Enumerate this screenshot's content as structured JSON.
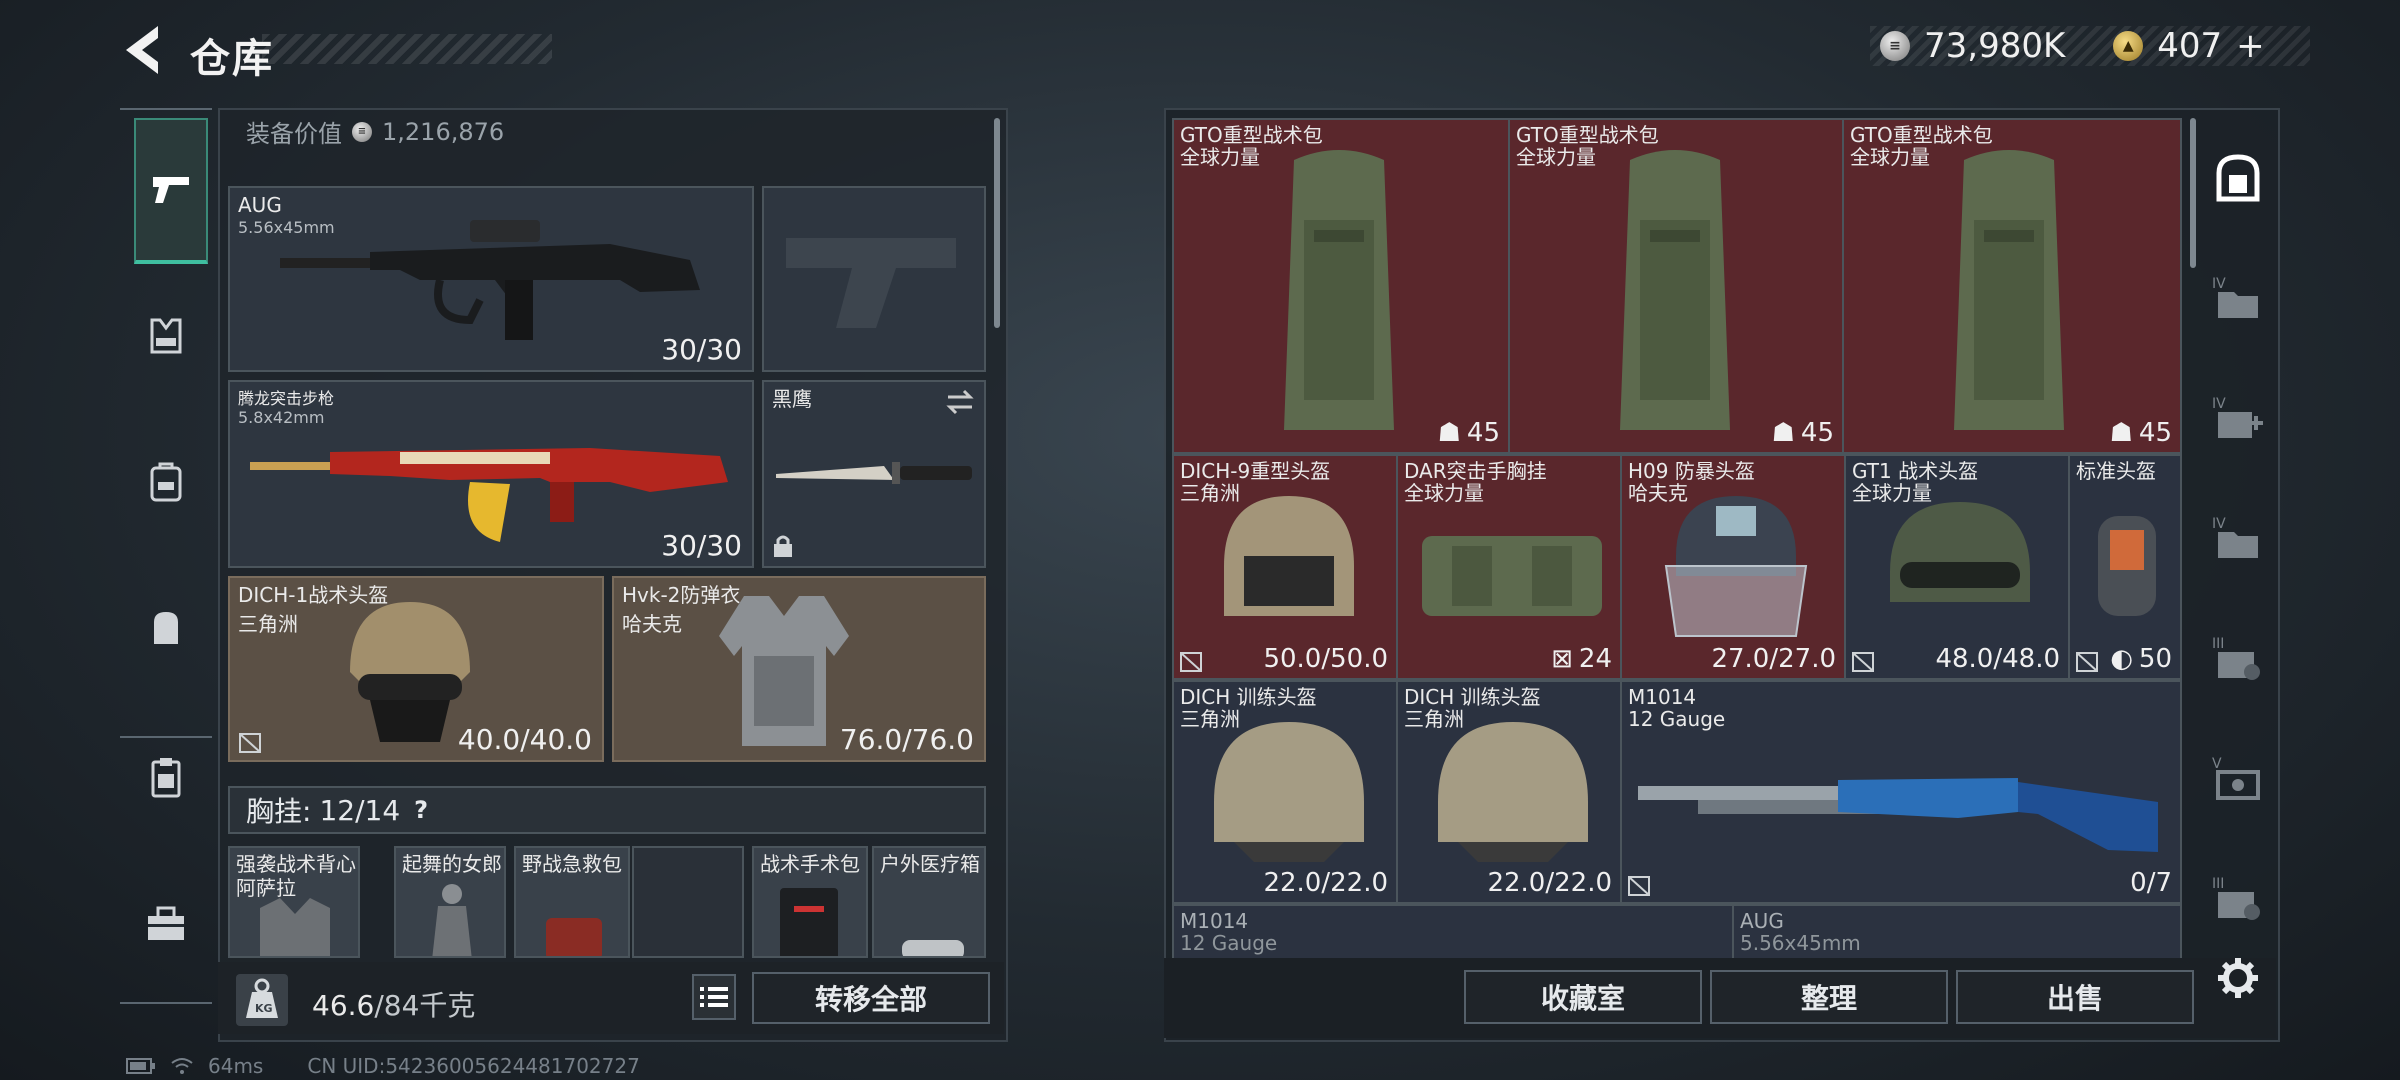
{
  "header": {
    "title": "仓库",
    "currency": [
      {
        "icon": "silver-coin-icon",
        "value": "73,980K"
      },
      {
        "icon": "gold-coin-icon",
        "value": "407",
        "plus": "+"
      }
    ]
  },
  "left_nav": {
    "items": [
      "weapon-icon",
      "vest-icon",
      "backpack-icon",
      "bag-icon",
      "clipboard-icon",
      "toolbox-icon"
    ]
  },
  "equipment": {
    "value_label": "装备价值",
    "value": "1,216,876",
    "slots": [
      {
        "name": "AUG",
        "caliber": "5.56x45mm",
        "value": "30/30"
      },
      {
        "name": "",
        "caliber": "",
        "value": ""
      },
      {
        "name": "腾龙突击步枪",
        "caliber": "5.8x42mm",
        "value": "30/30"
      },
      {
        "name": "黑鹰",
        "caliber": "",
        "value": ""
      },
      {
        "name": "DICH-1战术头盔",
        "sub": "三角洲",
        "value": "40.0/40.0"
      },
      {
        "name": "Hvk-2防弹衣",
        "sub": "哈夫克",
        "value": "76.0/76.0"
      }
    ],
    "chest": {
      "label": "胸挂:",
      "value": "12/14",
      "help": "?"
    },
    "chest_items": [
      {
        "name": "强袭战术背心",
        "sub": "阿萨拉"
      },
      {
        "name": "起舞的女郎",
        "sub": ""
      },
      {
        "name": "野战急救包",
        "sub": ""
      },
      {
        "name": "",
        "sub": ""
      },
      {
        "name": "战术手术包",
        "sub": ""
      },
      {
        "name": "户外医疗箱",
        "sub": ""
      }
    ]
  },
  "bottom_left": {
    "weight_current": "46.6",
    "weight_max": "/84千克",
    "transfer_all": "转移全部"
  },
  "status": {
    "ping": "64ms",
    "uid": "CN UID:54236005624481702727"
  },
  "storage": {
    "row1": [
      {
        "name": "GTO重型战术包",
        "sub": "全球力量",
        "count": "45"
      },
      {
        "name": "GTO重型战术包",
        "sub": "全球力量",
        "count": "45"
      },
      {
        "name": "GTO重型战术包",
        "sub": "全球力量",
        "count": "45"
      }
    ],
    "row2": [
      {
        "name": "DICH-9重型头盔",
        "sub": "三角洲",
        "value": "50.0/50.0"
      },
      {
        "name": "DAR突击手胸挂",
        "sub": "全球力量",
        "value": "24"
      },
      {
        "name": "H09 防暴头盔",
        "sub": "哈夫克",
        "value": "27.0/27.0"
      },
      {
        "name": "GT1 战术头盔",
        "sub": "全球力量",
        "value": "48.0/48.0"
      },
      {
        "name": "标准头盔",
        "sub": "",
        "value": "50"
      }
    ],
    "row3": [
      {
        "name": "DICH 训练头盔",
        "sub": "三角洲",
        "value": "22.0/22.0"
      },
      {
        "name": "DICH 训练头盔",
        "sub": "三角洲",
        "value": "22.0/22.0"
      },
      {
        "name": "M1014",
        "sub": "12 Gauge",
        "value": "0/7"
      }
    ],
    "row4": [
      {
        "name": "M1014",
        "sub": "12 Gauge"
      },
      {
        "name": "AUG",
        "sub": "5.56x45mm"
      }
    ]
  },
  "bottom_right": {
    "collection": "收藏室",
    "sort": "整理",
    "sell": "出售"
  },
  "right_nav": {
    "items": [
      "safe-box-icon",
      "folder-iv-icon",
      "medical-iv-icon",
      "folder-iv-2-icon",
      "tool-iii-icon",
      "ammo-v-icon",
      "tool-iii-2-icon"
    ]
  },
  "colors": {
    "accent": "#3fbfa0",
    "red_slot": "#5a272c",
    "brown_slot": "#5b5045"
  }
}
